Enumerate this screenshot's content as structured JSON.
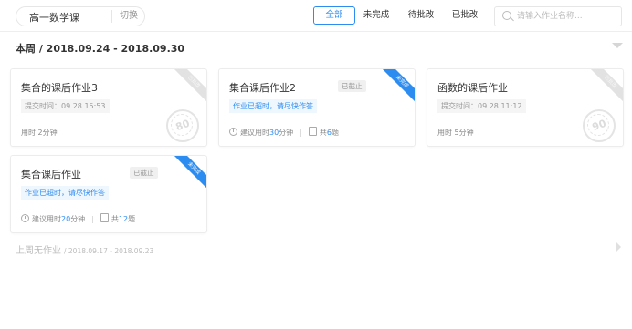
{
  "header": {
    "course_name": "高一数学课",
    "switch_label": "切换",
    "filters": [
      {
        "label": "全部",
        "active": true
      },
      {
        "label": "未完成",
        "active": false
      },
      {
        "label": "待批改",
        "active": false
      },
      {
        "label": "已批改",
        "active": false
      }
    ],
    "search_placeholder": "请输入作业名称..."
  },
  "current_week": {
    "title": "本周 / 2018.09.24 - 2018.09.30"
  },
  "cards": [
    {
      "title": "集合的课后作业3",
      "submit_time": "提交时间：09.28 15:53",
      "duration_prefix": "用时 ",
      "duration": "2分钟",
      "ribbon": "已批改",
      "score": "80"
    },
    {
      "title": "集合课后作业2",
      "badge": "已截止",
      "overdue_tip": "作业已超时，请尽快作答",
      "suggest_prefix": "建议用时",
      "suggest_value": "30",
      "suggest_unit": "分钟",
      "count_prefix": "共",
      "count_value": "6",
      "count_unit": "题",
      "ribbon": "未完成"
    },
    {
      "title": "函数的课后作业",
      "submit_time": "提交时间：09.28 11:12",
      "duration_prefix": "用时 ",
      "duration": "5分钟",
      "ribbon": "已批改",
      "score": "90"
    },
    {
      "title": "集合课后作业",
      "badge": "已截止",
      "overdue_tip": "作业已超时，请尽快作答",
      "suggest_prefix": "建议用时",
      "suggest_value": "20",
      "suggest_unit": "分钟",
      "count_prefix": "共",
      "count_value": "12",
      "count_unit": "题",
      "ribbon": "未完成"
    }
  ],
  "previous_week": {
    "label": "上周无作业",
    "range": "/ 2018.09.17 - 2018.09.23"
  },
  "colors": {
    "accent": "#2d8cf0",
    "border": "#ececec",
    "muted_text": "#999999"
  }
}
